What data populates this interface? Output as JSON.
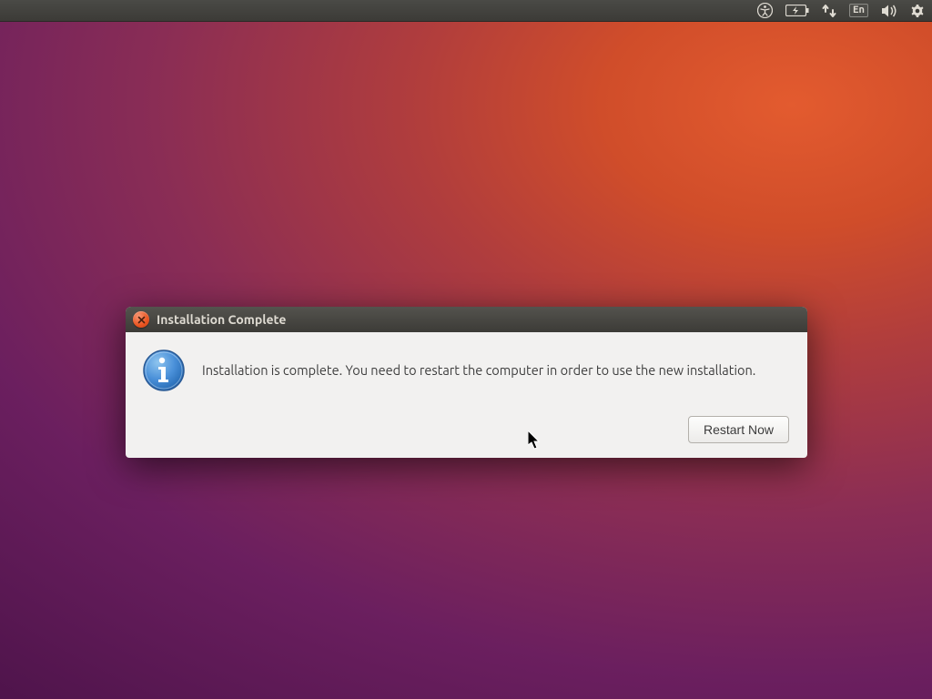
{
  "menubar": {
    "language": "En"
  },
  "dialog": {
    "title": "Installation Complete",
    "message": "Installation is complete. You need to restart the computer in order to use the new installation.",
    "restart_label": "Restart Now"
  }
}
